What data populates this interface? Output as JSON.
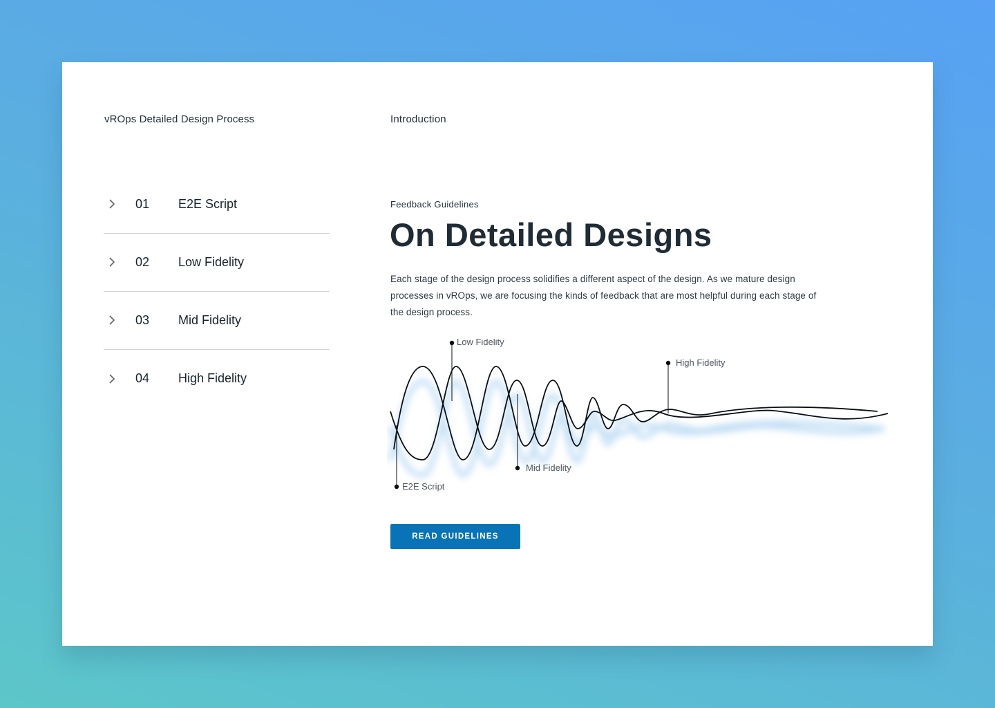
{
  "app_title": "vROps Detailed Design Process",
  "section_title": "Introduction",
  "steps": [
    {
      "number": "01",
      "label": "E2E Script",
      "icon": "chevron-right-icon"
    },
    {
      "number": "02",
      "label": "Low Fidelity",
      "icon": "chevron-right-icon"
    },
    {
      "number": "03",
      "label": "Mid Fidelity",
      "icon": "chevron-right-icon"
    },
    {
      "number": "04",
      "label": "High Fidelity",
      "icon": "chevron-right-icon"
    }
  ],
  "content": {
    "eyebrow": "Feedback Guidelines",
    "headline": "On Detailed Designs",
    "body": "Each stage of the design process solidifies a different aspect of the design. As we mature design processes in vROps, we are focusing the kinds of feedback that are most helpful during each stage of the design process."
  },
  "wave": {
    "labels": {
      "e2e": "E2E Script",
      "low": "Low Fidelity",
      "mid": "Mid Fidelity",
      "high": "High Fidelity"
    }
  },
  "cta": {
    "label": "READ GUIDELINES"
  },
  "colors": {
    "accent": "#0873b7",
    "text": "#1f2b35",
    "background_top": "#58a1f4",
    "background_bottom": "#5cc6c9"
  }
}
